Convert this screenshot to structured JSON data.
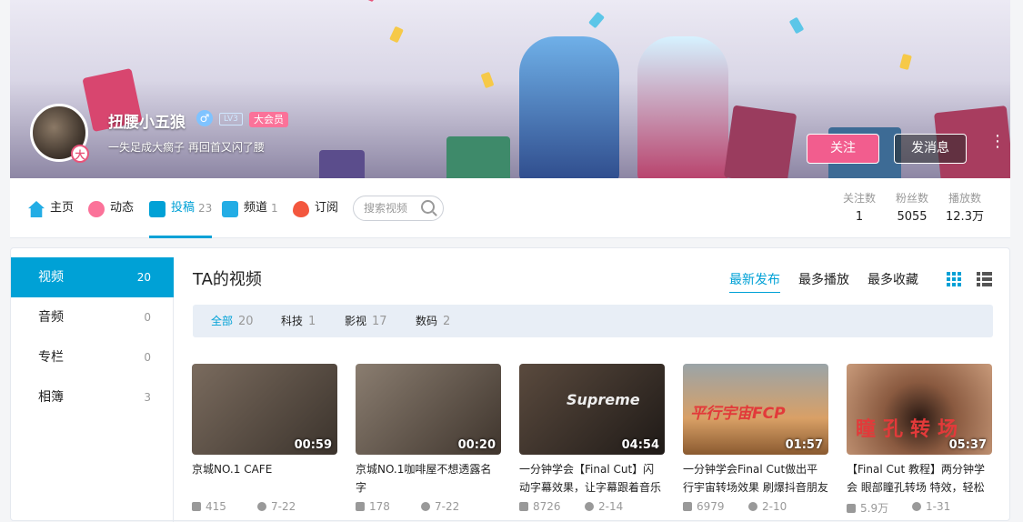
{
  "profile": {
    "username": "扭腰小五狼",
    "gender_symbol": "♂",
    "level": "LV3",
    "vip_label": "大会员",
    "signature": "一失足成大瘸子 再回首又闪了腰",
    "avatar_badge": "大",
    "follow_label": "关注",
    "message_label": "发消息",
    "more_symbol": "⋮"
  },
  "nav": {
    "items": [
      {
        "label": "主页",
        "count": "",
        "icon": "home-icon",
        "color": "#23ade5"
      },
      {
        "label": "动态",
        "count": "",
        "icon": "dynamic-icon",
        "color": "#fb7299"
      },
      {
        "label": "投稿",
        "count": "23",
        "icon": "upload-icon",
        "color": "#00a1d6"
      },
      {
        "label": "频道",
        "count": "1",
        "icon": "channel-icon",
        "color": "#23ade5"
      },
      {
        "label": "订阅",
        "count": "",
        "icon": "heart-icon",
        "color": "#f3573e"
      }
    ],
    "search_placeholder": "搜索视频",
    "stats": [
      {
        "label": "关注数",
        "value": "1"
      },
      {
        "label": "粉丝数",
        "value": "5055"
      },
      {
        "label": "播放数",
        "value": "12.3万"
      }
    ]
  },
  "sidebar": {
    "items": [
      {
        "label": "视频",
        "count": "20"
      },
      {
        "label": "音频",
        "count": "0"
      },
      {
        "label": "专栏",
        "count": "0"
      },
      {
        "label": "相簿",
        "count": "3"
      }
    ]
  },
  "main": {
    "title": "TA的视频",
    "sort": [
      "最新发布",
      "最多播放",
      "最多收藏"
    ],
    "filters": [
      {
        "label": "全部",
        "count": "20"
      },
      {
        "label": "科技",
        "count": "1"
      },
      {
        "label": "影视",
        "count": "17"
      },
      {
        "label": "数码",
        "count": "2"
      }
    ],
    "videos": [
      {
        "title": "京城NO.1 CAFE",
        "duration": "00:59",
        "plays": "415",
        "date": "7-22",
        "thumb_color": "#5d5147"
      },
      {
        "title": "京城NO.1咖啡屋不想透露名字",
        "duration": "00:20",
        "plays": "178",
        "date": "7-22",
        "thumb_color": "#6a5d52"
      },
      {
        "title": "一分钟学会【Final Cut】闪动字幕效果，让字幕跟着音乐",
        "duration": "04:54",
        "plays": "8726",
        "date": "2-14",
        "thumb_color": "#3b342e",
        "overlay": "Supreme"
      },
      {
        "title": "一分钟学会Final Cut做出平行宇宙转场效果 刷爆抖音朋友",
        "duration": "01:57",
        "plays": "6979",
        "date": "2-10",
        "thumb_color": "#c8955e",
        "overlay": "平行宇宙FCP"
      },
      {
        "title": "【Final Cut 教程】两分钟学会 眼部瞳孔转场 特效，轻松",
        "duration": "05:37",
        "plays": "5.9万",
        "date": "1-31",
        "thumb_color": "#6b3f2c",
        "overlay": "瞳孔转场"
      }
    ]
  }
}
